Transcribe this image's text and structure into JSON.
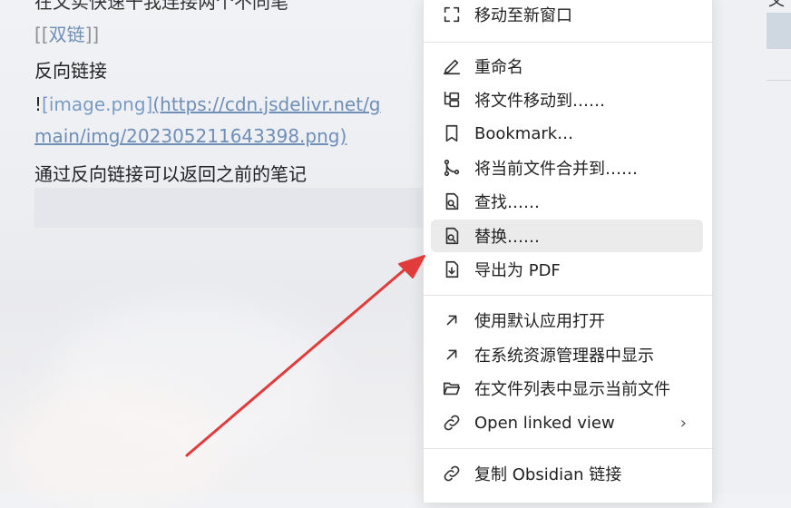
{
  "editor": {
    "cut_top_text": "在文实快速干我连接两个不同笔",
    "wikilink_open": "[[",
    "wikilink_text": "双链",
    "wikilink_close": "]]",
    "heading": "反向链接",
    "image_bang": "!",
    "image_alt": "[image.png]",
    "image_url_part1": "(https://cdn.jsdelivr.net/g",
    "image_url_part2": "main/img/202305211643398.png)",
    "body": "通过反向链接可以返回之前的笔记"
  },
  "menu": {
    "items": [
      {
        "label": "移动至新窗口",
        "icon": "expand-icon"
      },
      {
        "label": "重命名",
        "icon": "pencil-icon"
      },
      {
        "label": "将文件移动到……",
        "icon": "folder-tree-icon"
      },
      {
        "label": "Bookmark…",
        "icon": "bookmark-icon"
      },
      {
        "label": "将当前文件合并到……",
        "icon": "git-merge-icon"
      },
      {
        "label": "查找……",
        "icon": "file-search-icon"
      },
      {
        "label": "替换……",
        "icon": "file-search-icon"
      },
      {
        "label": "导出为 PDF",
        "icon": "file-download-icon"
      },
      {
        "label": "使用默认应用打开",
        "icon": "arrow-up-right-icon"
      },
      {
        "label": "在系统资源管理器中显示",
        "icon": "arrow-up-right-icon"
      },
      {
        "label": "在文件列表中显示当前文件",
        "icon": "folder-open-icon"
      },
      {
        "label": "Open linked view",
        "icon": "link-icon"
      },
      {
        "label": "复制 Obsidian 链接",
        "icon": "link-icon"
      }
    ],
    "submenu_chevron": "›"
  },
  "right_panel": {
    "top_text": "文件"
  },
  "colors": {
    "highlight": "#ebebeb",
    "arrow": "#e23b3b",
    "link": "#6f8fb6"
  }
}
